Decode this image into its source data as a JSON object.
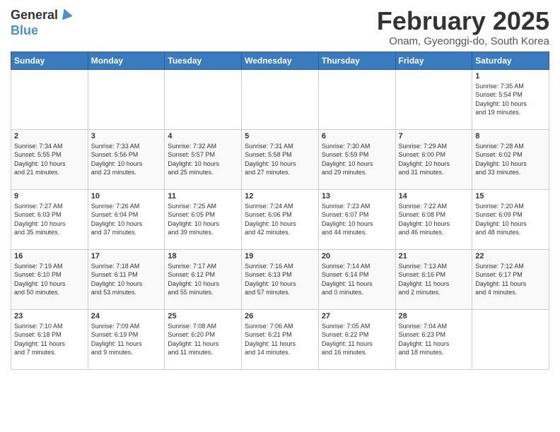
{
  "header": {
    "logo_general": "General",
    "logo_blue": "Blue",
    "month_title": "February 2025",
    "subtitle": "Onam, Gyeonggi-do, South Korea"
  },
  "weekdays": [
    "Sunday",
    "Monday",
    "Tuesday",
    "Wednesday",
    "Thursday",
    "Friday",
    "Saturday"
  ],
  "weeks": [
    [
      {
        "day": "",
        "info": ""
      },
      {
        "day": "",
        "info": ""
      },
      {
        "day": "",
        "info": ""
      },
      {
        "day": "",
        "info": ""
      },
      {
        "day": "",
        "info": ""
      },
      {
        "day": "",
        "info": ""
      },
      {
        "day": "1",
        "info": "Sunrise: 7:35 AM\nSunset: 5:54 PM\nDaylight: 10 hours\nand 19 minutes."
      }
    ],
    [
      {
        "day": "2",
        "info": "Sunrise: 7:34 AM\nSunset: 5:55 PM\nDaylight: 10 hours\nand 21 minutes."
      },
      {
        "day": "3",
        "info": "Sunrise: 7:33 AM\nSunset: 5:56 PM\nDaylight: 10 hours\nand 23 minutes."
      },
      {
        "day": "4",
        "info": "Sunrise: 7:32 AM\nSunset: 5:57 PM\nDaylight: 10 hours\nand 25 minutes."
      },
      {
        "day": "5",
        "info": "Sunrise: 7:31 AM\nSunset: 5:58 PM\nDaylight: 10 hours\nand 27 minutes."
      },
      {
        "day": "6",
        "info": "Sunrise: 7:30 AM\nSunset: 5:59 PM\nDaylight: 10 hours\nand 29 minutes."
      },
      {
        "day": "7",
        "info": "Sunrise: 7:29 AM\nSunset: 6:00 PM\nDaylight: 10 hours\nand 31 minutes."
      },
      {
        "day": "8",
        "info": "Sunrise: 7:28 AM\nSunset: 6:02 PM\nDaylight: 10 hours\nand 33 minutes."
      }
    ],
    [
      {
        "day": "9",
        "info": "Sunrise: 7:27 AM\nSunset: 6:03 PM\nDaylight: 10 hours\nand 35 minutes."
      },
      {
        "day": "10",
        "info": "Sunrise: 7:26 AM\nSunset: 6:04 PM\nDaylight: 10 hours\nand 37 minutes."
      },
      {
        "day": "11",
        "info": "Sunrise: 7:25 AM\nSunset: 6:05 PM\nDaylight: 10 hours\nand 39 minutes."
      },
      {
        "day": "12",
        "info": "Sunrise: 7:24 AM\nSunset: 6:06 PM\nDaylight: 10 hours\nand 42 minutes."
      },
      {
        "day": "13",
        "info": "Sunrise: 7:23 AM\nSunset: 6:07 PM\nDaylight: 10 hours\nand 44 minutes."
      },
      {
        "day": "14",
        "info": "Sunrise: 7:22 AM\nSunset: 6:08 PM\nDaylight: 10 hours\nand 46 minutes."
      },
      {
        "day": "15",
        "info": "Sunrise: 7:20 AM\nSunset: 6:09 PM\nDaylight: 10 hours\nand 48 minutes."
      }
    ],
    [
      {
        "day": "16",
        "info": "Sunrise: 7:19 AM\nSunset: 6:10 PM\nDaylight: 10 hours\nand 50 minutes."
      },
      {
        "day": "17",
        "info": "Sunrise: 7:18 AM\nSunset: 6:11 PM\nDaylight: 10 hours\nand 53 minutes."
      },
      {
        "day": "18",
        "info": "Sunrise: 7:17 AM\nSunset: 6:12 PM\nDaylight: 10 hours\nand 55 minutes."
      },
      {
        "day": "19",
        "info": "Sunrise: 7:16 AM\nSunset: 6:13 PM\nDaylight: 10 hours\nand 57 minutes."
      },
      {
        "day": "20",
        "info": "Sunrise: 7:14 AM\nSunset: 6:14 PM\nDaylight: 11 hours\nand 0 minutes."
      },
      {
        "day": "21",
        "info": "Sunrise: 7:13 AM\nSunset: 6:16 PM\nDaylight: 11 hours\nand 2 minutes."
      },
      {
        "day": "22",
        "info": "Sunrise: 7:12 AM\nSunset: 6:17 PM\nDaylight: 11 hours\nand 4 minutes."
      }
    ],
    [
      {
        "day": "23",
        "info": "Sunrise: 7:10 AM\nSunset: 6:18 PM\nDaylight: 11 hours\nand 7 minutes."
      },
      {
        "day": "24",
        "info": "Sunrise: 7:09 AM\nSunset: 6:19 PM\nDaylight: 11 hours\nand 9 minutes."
      },
      {
        "day": "25",
        "info": "Sunrise: 7:08 AM\nSunset: 6:20 PM\nDaylight: 11 hours\nand 11 minutes."
      },
      {
        "day": "26",
        "info": "Sunrise: 7:06 AM\nSunset: 6:21 PM\nDaylight: 11 hours\nand 14 minutes."
      },
      {
        "day": "27",
        "info": "Sunrise: 7:05 AM\nSunset: 6:22 PM\nDaylight: 11 hours\nand 16 minutes."
      },
      {
        "day": "28",
        "info": "Sunrise: 7:04 AM\nSunset: 6:23 PM\nDaylight: 11 hours\nand 18 minutes."
      },
      {
        "day": "",
        "info": ""
      }
    ]
  ]
}
